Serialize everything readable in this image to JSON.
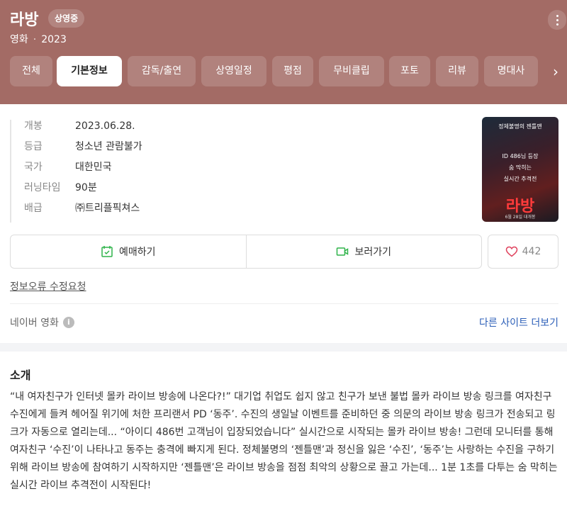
{
  "header": {
    "title": "라방",
    "badge": "상영중",
    "genre": "영화",
    "separator": "·",
    "year": "2023",
    "color": "#a36b65"
  },
  "tabs": [
    {
      "label": "전체",
      "active": false
    },
    {
      "label": "기본정보",
      "active": true
    },
    {
      "label": "감독/출연",
      "active": false
    },
    {
      "label": "상영일정",
      "active": false
    },
    {
      "label": "평점",
      "active": false
    },
    {
      "label": "무비클립",
      "active": false
    },
    {
      "label": "포토",
      "active": false
    },
    {
      "label": "리뷰",
      "active": false
    },
    {
      "label": "명대사",
      "active": false
    }
  ],
  "info": [
    {
      "key": "개봉",
      "value": "2023.06.28."
    },
    {
      "key": "등급",
      "value": "청소년 관람불가"
    },
    {
      "key": "국가",
      "value": "대한민국"
    },
    {
      "key": "러닝타임",
      "value": "90분"
    },
    {
      "key": "배급",
      "value": "㈜트리플픽쳐스"
    }
  ],
  "poster": {
    "top_text": "정체불명의 젠틀맨",
    "mid_text": [
      "ID 486님 등장",
      "숨 막히는",
      "실시간 추격전"
    ],
    "title": "라방",
    "date": "6월 28일 대개봉"
  },
  "actions": {
    "book_label": "예매하기",
    "watch_label": "보러가기",
    "like_count": "442"
  },
  "report_link": "정보오류 수정요청",
  "source": {
    "label": "네이버 영화",
    "more_label": "다른 사이트 더보기"
  },
  "intro": {
    "title": "소개",
    "text": "“내 여자친구가 인터넷 몰카 라이브 방송에 나온다?!” 대기업 취업도 쉽지 않고 친구가 보낸 불법 몰카 라이브 방송 링크를 여자친구 수진에게 들켜 헤어질 위기에 처한 프리랜서 PD ‘동주’. 수진의 생일날 이벤트를 준비하던 중 의문의 라이브 방송 링크가 전송되고 링크가 자동으로 열리는데... “아이디 486번 고객님이 입장되었습니다” 실시간으로 시작되는 몰카 라이브 방송! 그런데 모니터를 통해 여자친구 ‘수진’이 나타나고 동주는 충격에 빠지게 된다. 정체불명의 ‘젠틀맨’과 정신을 잃은 ‘수진’, ‘동주’는 사랑하는 수진을 구하기 위해 라이브 방송에 참여하기 시작하지만 ‘젠틀맨’은 라이브 방송을 점점 최악의 상황으로 끌고 가는데... 1분 1초를 다투는 숨 막히는 실시간 라이브 추격전이 시작된다!"
  }
}
